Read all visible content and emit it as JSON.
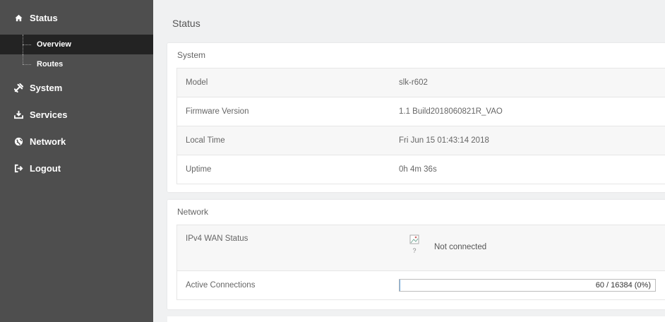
{
  "sidebar": {
    "items": [
      {
        "label": "Status",
        "icon": "home-icon"
      },
      {
        "label": "System",
        "icon": "tools-icon"
      },
      {
        "label": "Services",
        "icon": "download-icon"
      },
      {
        "label": "Network",
        "icon": "globe-icon"
      },
      {
        "label": "Logout",
        "icon": "logout-icon"
      }
    ],
    "status_sub": [
      {
        "label": "Overview",
        "active": true
      },
      {
        "label": "Routes",
        "active": false
      }
    ]
  },
  "main": {
    "title": "Status",
    "system": {
      "title": "System",
      "rows": [
        {
          "key": "Model",
          "value": "slk-r602"
        },
        {
          "key": "Firmware Version",
          "value": "1.1 Build2018060821R_VAO"
        },
        {
          "key": "Local Time",
          "value": "Fri Jun 15 01:43:14 2018"
        },
        {
          "key": "Uptime",
          "value": "0h 4m 36s"
        }
      ]
    },
    "network": {
      "title": "Network",
      "wan_label": "IPv4 WAN Status",
      "wan_icon_caption": "?",
      "wan_status": "Not connected",
      "conn_label": "Active Connections",
      "conn_text": "60 / 16384 (0%)",
      "conn_fraction": 0.0037
    }
  },
  "colors": {
    "sidebar_bg": "#4e4e4e",
    "sidebar_active": "#232323",
    "page_bg": "#f0f1f2"
  }
}
